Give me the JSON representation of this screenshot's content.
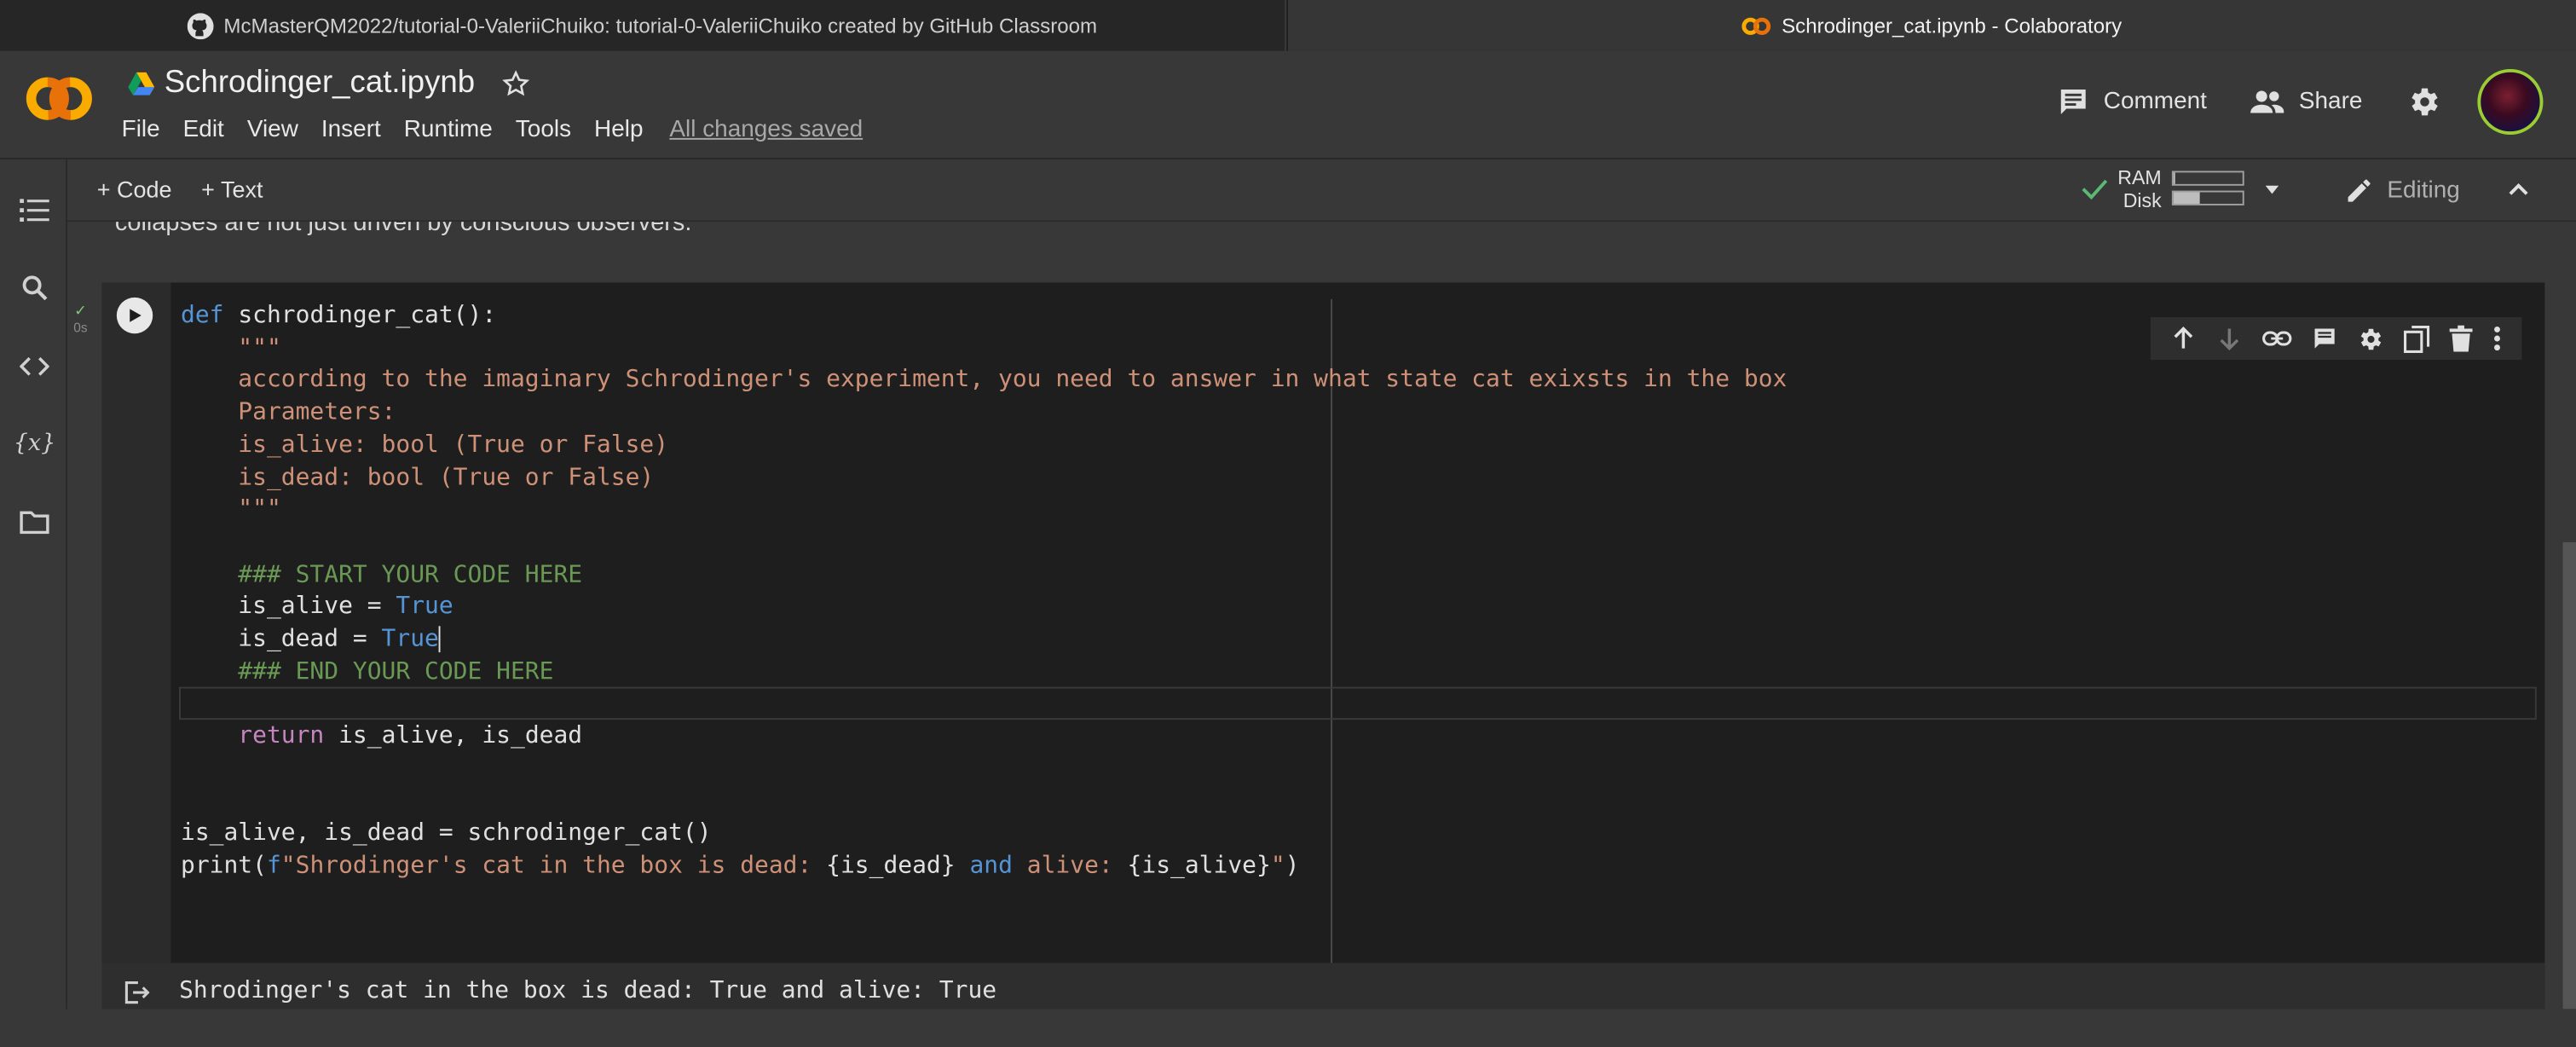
{
  "browser": {
    "tab1_title": "McMasterQM2022/tutorial-0-ValeriiChuiko: tutorial-0-ValeriiChuiko created by GitHub Classroom",
    "tab2_title": "Schrodinger_cat.ipynb - Colaboratory"
  },
  "header": {
    "notebook_title": "Schrodinger_cat.ipynb",
    "menu": [
      "File",
      "Edit",
      "View",
      "Insert",
      "Runtime",
      "Tools",
      "Help"
    ],
    "save_status": "All changes saved",
    "comment_label": "Comment",
    "share_label": "Share"
  },
  "toolbar": {
    "add_code": "+ Code",
    "add_text": "+ Text",
    "ram_label": "RAM",
    "disk_label": "Disk",
    "ram_usage": 0.04,
    "disk_usage": 0.38,
    "editing_label": "Editing"
  },
  "content": {
    "previous_cell_text": "collapses are not just driven by conscious observers."
  },
  "cell": {
    "status_check": "✓",
    "exec_time": "0s",
    "code_lines": [
      "def schrodinger_cat():",
      "    \"\"\"",
      "    according to the imaginary Schrodinger's experiment, you need to answer in what state cat exixsts in the box",
      "",
      "    Parameters:",
      "",
      "    is_alive: bool (True or False)",
      "    is_dead: bool (True or False)",
      "    \"\"\"",
      "",
      "    ### START YOUR CODE HERE",
      "    is_alive = True",
      "    is_dead = True",
      "    ### END YOUR CODE HERE",
      "",
      "    return is_alive, is_dead",
      "",
      "",
      "is_alive, is_dead = schrodinger_cat()",
      "print(f\"Shrodinger's cat in the box is dead: {is_dead} and alive: {is_alive}\")"
    ],
    "output": "Shrodinger's cat in the box is dead: True and alive: True"
  },
  "colors": {
    "background": "#383838",
    "cell_bg": "#1e1e1e",
    "keyword": "#5595d6",
    "string": "#ce9178",
    "comment": "#6a9955",
    "logo_orange": "#f9ab00"
  }
}
